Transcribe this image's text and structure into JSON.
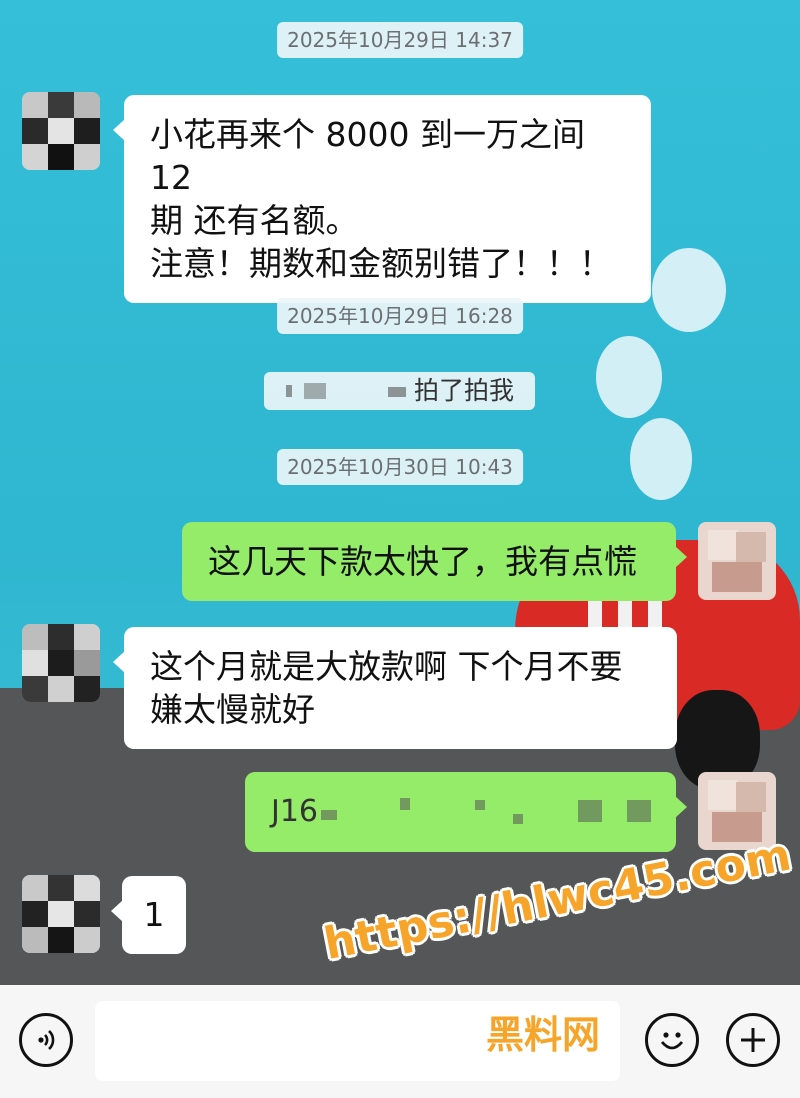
{
  "timestamps": [
    "2025年10月29日 14:37",
    "2025年10月29日 16:28",
    "2025年10月30日 10:43"
  ],
  "system_notice": "拍了拍我",
  "messages": [
    {
      "side": "incoming",
      "text": "小花再来个 8000 到一万之间 12\n期 还有名额。\n注意！期数和金额别错了！！！"
    },
    {
      "side": "outgoing",
      "text": "这几天下款太快了，我有点慌"
    },
    {
      "side": "incoming",
      "text": "这个月就是大放款啊 下个月不要\n嫌太慢就好"
    },
    {
      "side": "outgoing",
      "text": "J16"
    },
    {
      "side": "incoming",
      "text": "1"
    }
  ],
  "input_bar": {
    "voice_icon": "voice-icon",
    "emoji_icon": "emoji-icon",
    "plus_icon": "plus-icon"
  },
  "watermark": {
    "url": "https://hlwc45.com",
    "label": "黑料网"
  },
  "colors": {
    "outgoing_bubble": "#95ec69",
    "incoming_bubble": "#ffffff",
    "watermark": "#f7a52a"
  }
}
